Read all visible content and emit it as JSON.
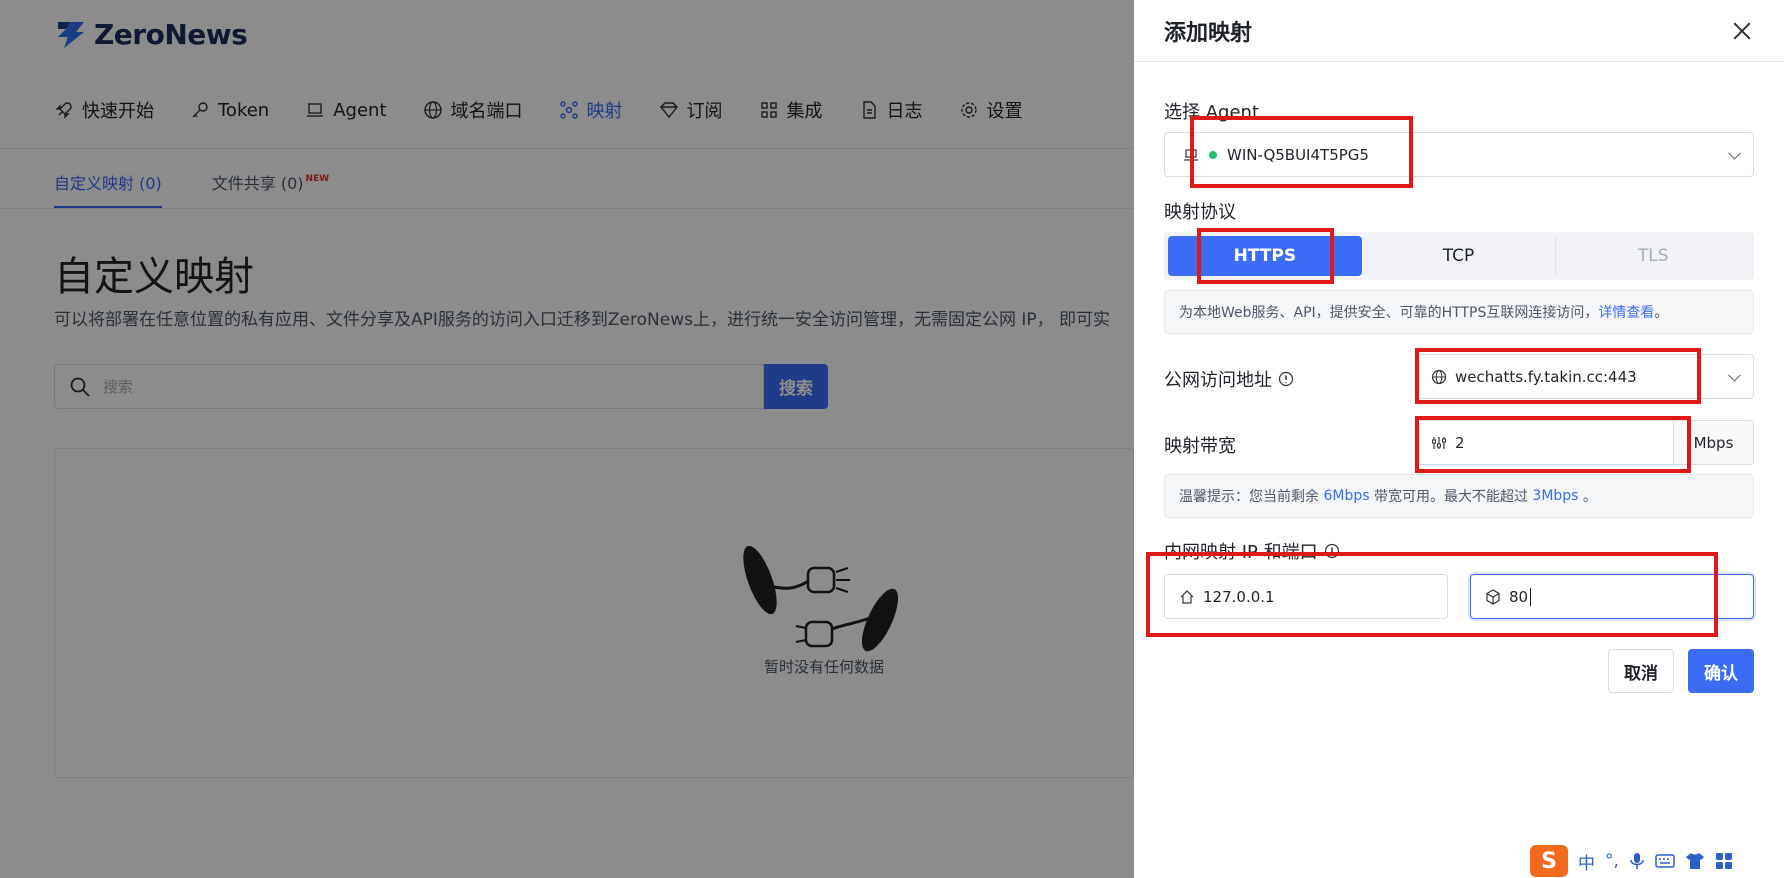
{
  "brand": {
    "name": "ZeroNews"
  },
  "topnav": [
    {
      "label": "快速开始",
      "icon": "rocket-icon"
    },
    {
      "label": "Token",
      "icon": "key-icon"
    },
    {
      "label": "Agent",
      "icon": "laptop-icon"
    },
    {
      "label": "域名端口",
      "icon": "globe-icon"
    },
    {
      "label": "映射",
      "icon": "mapping-icon",
      "active": true
    },
    {
      "label": "订阅",
      "icon": "diamond-icon"
    },
    {
      "label": "集成",
      "icon": "grid-icon"
    },
    {
      "label": "日志",
      "icon": "document-icon"
    },
    {
      "label": "设置",
      "icon": "gear-icon"
    }
  ],
  "subtabs": {
    "custom": "自定义映射 (0)",
    "fileshare": "文件共享 (0)",
    "new_badge": "NEW"
  },
  "main": {
    "title": "自定义映射",
    "description": "可以将部署在任意位置的私有应用、文件分享及API服务的访问入口迁移到ZeroNews上，进行统一安全访问管理，无需固定公网 IP， 即可实",
    "search_placeholder": "搜索",
    "search_button": "搜索",
    "empty_text": "暂时没有任何数据"
  },
  "drawer": {
    "title": "添加映射",
    "agent_label": "选择 Agent",
    "agent_value": "WIN-Q5BUI4T5PG5",
    "protocol_label": "映射协议",
    "protocols": [
      "HTTPS",
      "TCP",
      "TLS"
    ],
    "protocol_selected": "HTTPS",
    "protocol_info": "为本地Web服务、API，提供安全、可靠的HTTPS互联网连接访问，",
    "protocol_info_link": "详情查看",
    "protocol_info_end": "。",
    "address_label": "公网访问地址",
    "address_value": "wechatts.fy.takin.cc:443",
    "bandwidth_label": "映射带宽",
    "bandwidth_value": "2",
    "bandwidth_unit": "Mbps",
    "tip_prefix": "温馨提示：您当前剩余 ",
    "tip_remaining": "6Mbps",
    "tip_middle": " 带宽可用。最大不能超过 ",
    "tip_max": "3Mbps",
    "tip_end": " 。",
    "ip_port_label": "内网映射 IP 和端口",
    "ip_value": "127.0.0.1",
    "port_value": "80",
    "cancel": "取消",
    "confirm": "确认"
  },
  "ime": {
    "lang": "中",
    "punct": "°,"
  },
  "colors": {
    "accent": "#3b6cf6",
    "annotation": "#e01818",
    "online": "#24c16b"
  }
}
